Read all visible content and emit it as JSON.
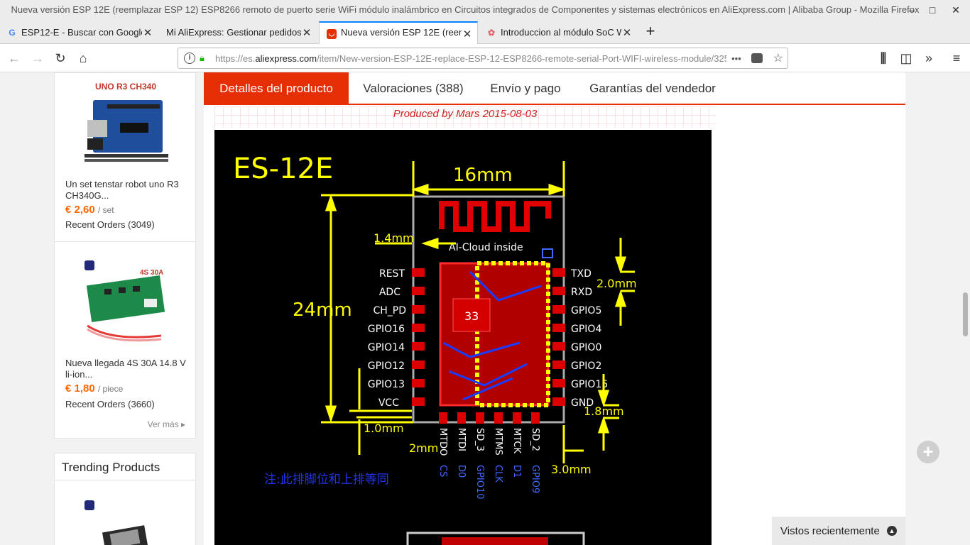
{
  "window": {
    "title": "Nueva versión ESP 12E (reemplazar ESP 12) ESP8266 remoto de puerto serie WiFi módulo inalámbrico en Circuitos integrados de Componentes y sistemas electrónicos en AliExpress.com | Alibaba Group - Mozilla Firefox",
    "minimize": "–",
    "maximize": "□",
    "close": "✕"
  },
  "tabs": [
    {
      "label": "ESP12-E - Buscar con Google",
      "icon": "google-icon",
      "close": "✕"
    },
    {
      "label": "Mi AliExpress: Gestionar pedidos",
      "icon": "",
      "close": "✕"
    },
    {
      "label": "Nueva versión ESP 12E (reem",
      "icon": "aliexpress-icon",
      "close": "✕"
    },
    {
      "label": "Introduccion al módulo SoC W",
      "icon": "blog-icon",
      "close": "✕"
    }
  ],
  "newtab": "+",
  "nav": {
    "url_prefix": "https://es.",
    "url_domain": "aliexpress.com",
    "url_rest": "/item/New-version-ESP-12E-replace-ESP-12-ESP8266-remote-serial-Port-WIFI-wireless-module/325",
    "more": "•••"
  },
  "sidebar": {
    "products": [
      {
        "image_label": "UNO R3 CH340",
        "name": "Un set tenstar robot uno R3 CH340G...",
        "price": "€ 2,60",
        "unit": "/ set",
        "orders": "Recent Orders (3049)"
      },
      {
        "image_label": "4S 30A",
        "name": "Nueva llegada 4S 30A 14.8 V li-ion...",
        "price": "€ 1,80",
        "unit": "/ piece",
        "orders": "Recent Orders (3660)"
      }
    ],
    "more": "Ver más ▸"
  },
  "trending": {
    "title": "Trending Products"
  },
  "product_tabs": [
    {
      "label": "Detalles del producto"
    },
    {
      "label": "Valoraciones (388)"
    },
    {
      "label": "Envío y pago"
    },
    {
      "label": "Garantías del vendedor"
    }
  ],
  "produced_by": "Produced by Mars  2015-08-03",
  "diagram": {
    "title": "ES-12E",
    "width_dim": "16mm",
    "height_dim": "24mm",
    "dim_1_4": "1.4mm",
    "dim_2_0": "2.0mm",
    "dim_1_0": "1.0mm",
    "dim_1_8": "1.8mm",
    "dim_2mm": "2mm",
    "dim_3_0": "3.0mm",
    "antenna_label": "AI-Cloud  inside",
    "chip_label": "33",
    "left_pins": [
      "REST",
      "ADC",
      "CH_PD",
      "GPIO16",
      "GPIO14",
      "GPIO12",
      "GPIO13",
      "VCC"
    ],
    "right_pins": [
      "TXD",
      "RXD",
      "GPIO5",
      "GPIO4",
      "GPIO0",
      "GPIO2",
      "GPIO15",
      "GND"
    ],
    "bottom_pins_top": [
      "MTDO",
      "MTDI",
      "SD_3",
      "MTMS",
      "MTCK",
      "SD_2"
    ],
    "bottom_pins_bottom": [
      "CS",
      "D0",
      "GPIO10",
      "CLK",
      "D1",
      "GPIO9"
    ],
    "note": "注:此排脚位和上排等同"
  },
  "plus_button": "+",
  "recently_viewed": "Vistos recientemente",
  "recently_viewed_icon": "▲",
  "colors": {
    "accent": "#e62e04",
    "price": "#ff6600",
    "firefox_blue": "#0a84ff"
  }
}
